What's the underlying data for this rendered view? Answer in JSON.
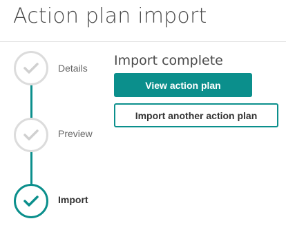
{
  "page": {
    "title": "Action plan import"
  },
  "stepper": {
    "steps": [
      {
        "label": "Details",
        "state": "done",
        "icon": "check-icon"
      },
      {
        "label": "Preview",
        "state": "done",
        "icon": "check-icon"
      },
      {
        "label": "Import",
        "state": "active",
        "icon": "check-icon"
      }
    ]
  },
  "main": {
    "heading": "Import complete",
    "primary_button": "View action plan",
    "secondary_button": "Import another action plan"
  },
  "colors": {
    "accent": "#0b8f8c",
    "inactive_circle": "#dcdcdc",
    "inactive_check": "#d0d0d0"
  }
}
